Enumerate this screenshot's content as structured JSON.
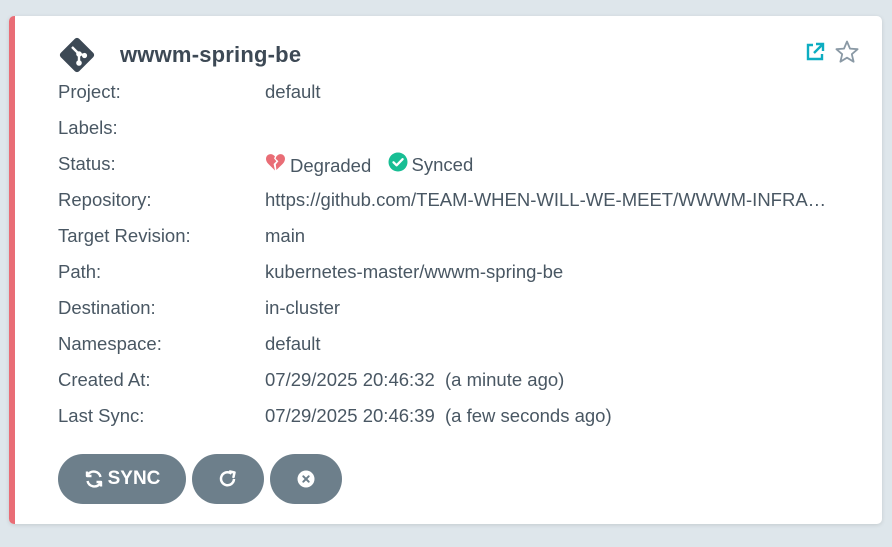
{
  "app": {
    "name": "wwwm-spring-be"
  },
  "fields": {
    "project": {
      "label": "Project:",
      "value": "default"
    },
    "labels": {
      "label": "Labels:",
      "value": ""
    },
    "status": {
      "label": "Status:",
      "health": "Degraded",
      "sync": "Synced"
    },
    "repository": {
      "label": "Repository:",
      "value": "https://github.com/TEAM-WHEN-WILL-WE-MEET/WWWM-INFRA…"
    },
    "target_revision": {
      "label": "Target Revision:",
      "value": "main"
    },
    "path": {
      "label": "Path:",
      "value": "kubernetes-master/wwwm-spring-be"
    },
    "destination": {
      "label": "Destination:",
      "value": "in-cluster"
    },
    "namespace": {
      "label": "Namespace:",
      "value": "default"
    },
    "created_at": {
      "label": "Created At:",
      "value": "07/29/2025 20:46:32  (a minute ago)"
    },
    "last_sync": {
      "label": "Last Sync:",
      "value": "07/29/2025 20:46:39  (a few seconds ago)"
    }
  },
  "actions": {
    "sync_label": "SYNC"
  },
  "icons": {
    "logo": "git-logo-icon",
    "external_link": "external-link-icon",
    "favorite": "star-icon",
    "health": "broken-heart-icon",
    "sync_status": "check-circle-icon",
    "sync_button": "sync-icon",
    "refresh_button": "refresh-icon",
    "delete_button": "close-circle-icon"
  },
  "colors": {
    "background": "#dee6eb",
    "card": "#ffffff",
    "status_stripe": "#e96d76",
    "degraded": "#e96d76",
    "synced": "#18be94",
    "link_accent": "#0dadc1",
    "button": "#6d7f8b",
    "text": "#495763"
  }
}
